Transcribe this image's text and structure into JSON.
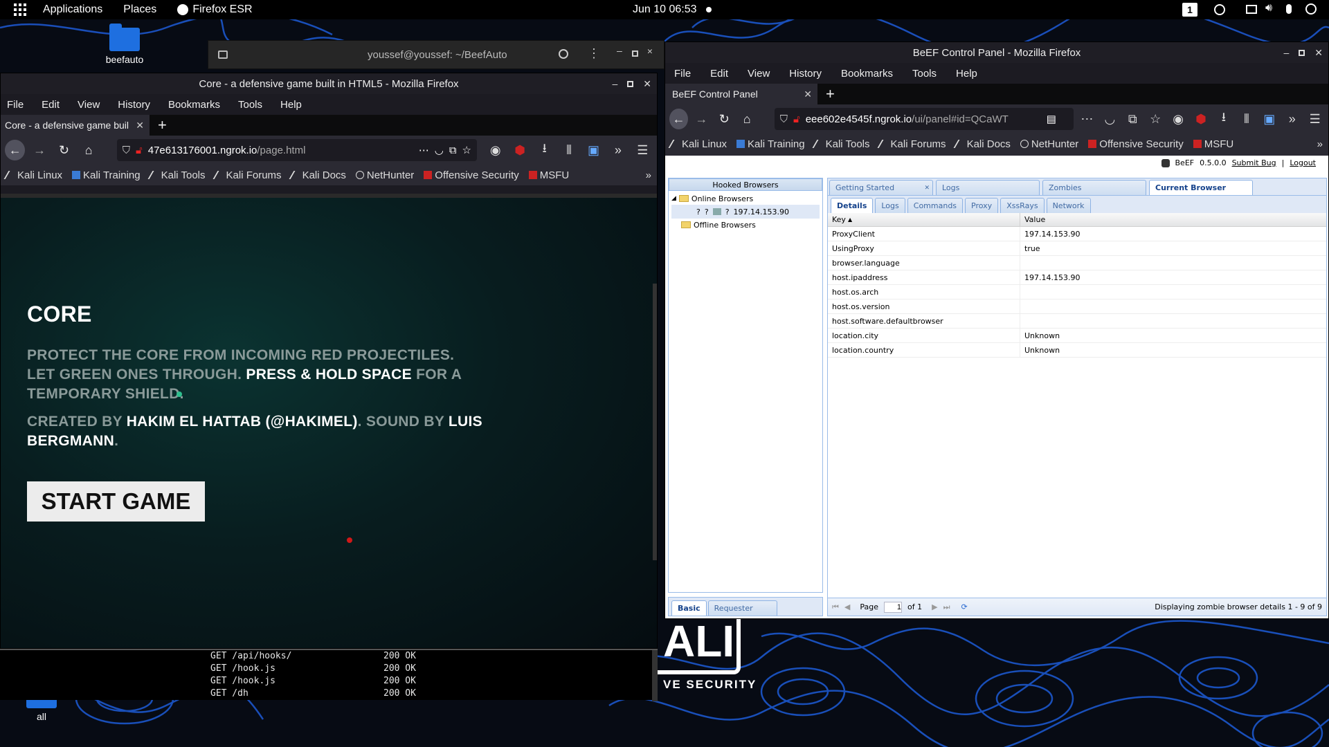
{
  "topbar": {
    "applications": "Applications",
    "places": "Places",
    "firefox_app": "Firefox ESR",
    "datetime": "Jun 10  06:53",
    "workspace": "1"
  },
  "desktop": {
    "icon_beefauto": "beefauto",
    "icon_all": "all",
    "kali_logo_text": "ALI",
    "kali_tagline": "VE SECURITY"
  },
  "terminal": {
    "title": "youssef@youssef: ~/BeefAuto",
    "lines": [
      {
        "request": "GET /api/hooks/",
        "status": "200 OK"
      },
      {
        "request": "GET /hook.js",
        "status": "200 OK"
      },
      {
        "request": "GET /hook.js",
        "status": "200 OK"
      },
      {
        "request": "GET /dh",
        "status": "200 OK"
      }
    ]
  },
  "left_firefox": {
    "title": "Core - a defensive game built in HTML5 - Mozilla Firefox",
    "menu": [
      "File",
      "Edit",
      "View",
      "History",
      "Bookmarks",
      "Tools",
      "Help"
    ],
    "tab_label": "Core - a defensive game buil",
    "url_host": "47e613176001.ngrok.io",
    "url_path": "/page.html",
    "bookmarks": [
      "Kali Linux",
      "Kali Training",
      "Kali Tools",
      "Kali Forums",
      "Kali Docs",
      "NetHunter",
      "Offensive Security",
      "MSFU"
    ],
    "game": {
      "heading": "CORE",
      "line1": "PROTECT THE CORE FROM INCOMING RED PROJECTILES.",
      "line2_a": "LET GREEN ONES THROUGH.",
      "line2_b": "PRESS & HOLD SPACE",
      "line2_c": "FOR A",
      "line3": "TEMPORARY SHIELD.",
      "credit_a": "CREATED BY",
      "credit_b": "HAKIM EL HATTAB (@HAKIMEL)",
      "credit_c": ". SOUND BY",
      "credit_d": "LUIS BERGMANN",
      "credit_e": ".",
      "start_button": "START GAME"
    }
  },
  "right_firefox": {
    "title": "BeEF Control Panel - Mozilla Firefox",
    "menu": [
      "File",
      "Edit",
      "View",
      "History",
      "Bookmarks",
      "Tools",
      "Help"
    ],
    "tab_label": "BeEF Control Panel",
    "url_host": "eee602e4545f.ngrok.io",
    "url_path": "/ui/panel#id=QCaWT",
    "bookmarks": [
      "Kali Linux",
      "Kali Training",
      "Kali Tools",
      "Kali Forums",
      "Kali Docs",
      "NetHunter",
      "Offensive Security",
      "MSFU"
    ],
    "beef": {
      "version_label": "BeEF",
      "version": "0.5.0.0",
      "submit_bug": "Submit  Bug",
      "logout": "Logout",
      "sep": "|",
      "hooked_header": "Hooked Browsers",
      "online": "Online Browsers",
      "online_ip": "197.14.153.90",
      "offline": "Offline Browsers",
      "main_tabs": [
        "Getting Started",
        "Logs",
        "Zombies",
        "Current Browser"
      ],
      "sub_tabs": [
        "Details",
        "Logs",
        "Commands",
        "Proxy",
        "XssRays",
        "Network"
      ],
      "col_key": "Key",
      "col_value": "Value",
      "rows": [
        {
          "key": "ProxyClient",
          "value": "197.14.153.90"
        },
        {
          "key": "UsingProxy",
          "value": "true"
        },
        {
          "key": "browser.language",
          "value": ""
        },
        {
          "key": "host.ipaddress",
          "value": "197.14.153.90"
        },
        {
          "key": "host.os.arch",
          "value": ""
        },
        {
          "key": "host.os.version",
          "value": ""
        },
        {
          "key": "host.software.defaultbrowser",
          "value": ""
        },
        {
          "key": "location.city",
          "value": "Unknown"
        },
        {
          "key": "location.country",
          "value": "Unknown"
        }
      ],
      "bottom_tabs": [
        "Basic",
        "Requester"
      ],
      "page_label": "Page",
      "page_value": "1",
      "page_of": "of 1",
      "status": "Displaying zombie browser details 1 - 9 of 9"
    }
  }
}
